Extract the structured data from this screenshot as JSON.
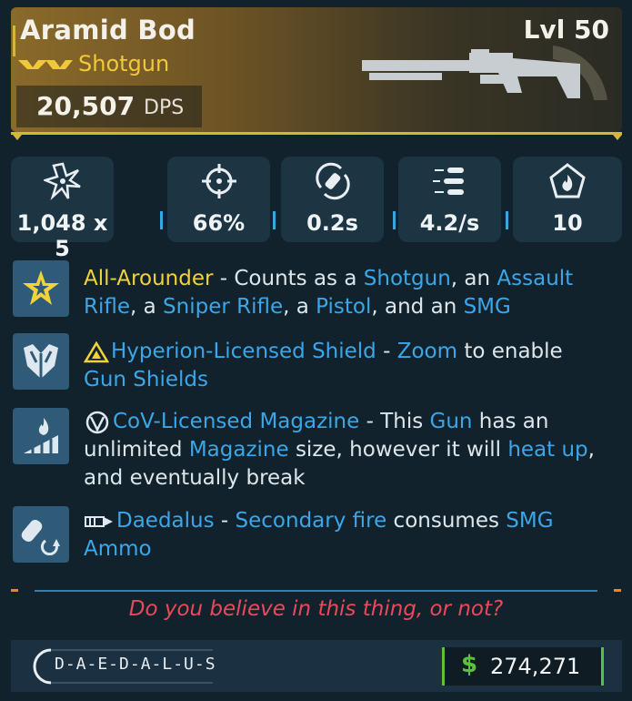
{
  "weapon": {
    "name": "Aramid Bod",
    "level": "Lvl 50",
    "type": "Shotgun",
    "rarity_icon": "rarity-chevrons-icon",
    "dps_value": "20,507",
    "dps_unit": "DPS",
    "accent_color": "#d4b63a"
  },
  "stats": [
    {
      "icon": "damage-burst-icon",
      "value": "1,048 x 5"
    },
    {
      "icon": "crosshair-icon",
      "value": "66%"
    },
    {
      "icon": "reload-icon",
      "value": "0.2s"
    },
    {
      "icon": "fire-rate-icon",
      "value": "4.2/s"
    },
    {
      "icon": "elemental-flame-icon",
      "value": "10"
    }
  ],
  "perks": [
    {
      "icon": "star-badge-icon",
      "title": "All-Arounder",
      "sep": " - ",
      "parts": [
        "Counts as a ",
        "Shotgun",
        ", an ",
        "Assault Rifle",
        ", a ",
        "Sniper Rifle",
        ", a ",
        "Pistol",
        ", and an ",
        "SMG"
      ]
    },
    {
      "icon": "shield-icon",
      "prefix_icon": "hyperion-triangle-icon",
      "title": "Hyperion-Licensed Shield",
      "sep": " - ",
      "parts": [
        "Zoom",
        " to enable ",
        "Gun Shields"
      ]
    },
    {
      "icon": "heat-magazine-icon",
      "prefix_icon": "cov-logo-icon",
      "title": "CoV-Licensed Magazine",
      "sep": " - ",
      "parts": [
        "This ",
        "Gun",
        " has an unlimited ",
        "Magazine",
        " size, however it will ",
        "heat up",
        ", and eventually break"
      ]
    },
    {
      "icon": "ammo-swap-icon",
      "prefix_icon": "daedalus-mark-icon",
      "title": "Daedalus",
      "sep": " - ",
      "parts": [
        "Secondary fire",
        " consumes ",
        "SMG Ammo"
      ]
    }
  ],
  "flavor_text": "Do you believe in this thing, or not?",
  "footer": {
    "manufacturer": "D-A-E-D-A-L-U-S",
    "currency_symbol": "$",
    "price": "274,271"
  }
}
